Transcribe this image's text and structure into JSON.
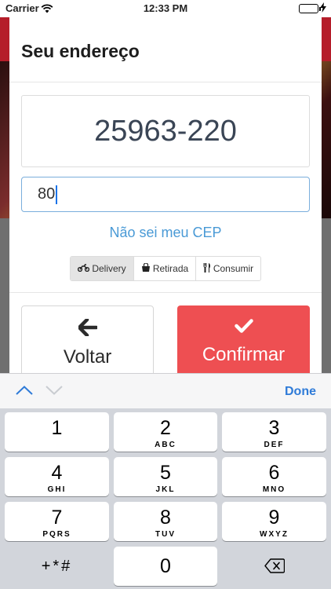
{
  "status_bar": {
    "carrier": "Carrier",
    "time": "12:33 PM"
  },
  "modal": {
    "title": "Seu endereço",
    "cep_value": "25963-220",
    "number_value": "80",
    "help_link": "Não sei meu CEP",
    "options": [
      {
        "label": "Delivery",
        "icon": "motorcycle-icon",
        "selected": true
      },
      {
        "label": "Retirada",
        "icon": "shopping-bag-icon",
        "selected": false
      },
      {
        "label": "Consumir",
        "icon": "fork-knife-icon",
        "selected": false
      }
    ],
    "back_button": {
      "label": "Voltar",
      "icon": "arrow-left-icon"
    },
    "confirm_button": {
      "label": "Confirmar",
      "icon": "check-icon"
    }
  },
  "keyboard": {
    "done_label": "Done",
    "keys": [
      {
        "digit": "1",
        "letters": ""
      },
      {
        "digit": "2",
        "letters": "ABC"
      },
      {
        "digit": "3",
        "letters": "DEF"
      },
      {
        "digit": "4",
        "letters": "GHI"
      },
      {
        "digit": "5",
        "letters": "JKL"
      },
      {
        "digit": "6",
        "letters": "MNO"
      },
      {
        "digit": "7",
        "letters": "PQRS"
      },
      {
        "digit": "8",
        "letters": "TUV"
      },
      {
        "digit": "9",
        "letters": "WXYZ"
      },
      {
        "digit": "0",
        "letters": ""
      }
    ],
    "symbols_label": "+*#"
  },
  "colors": {
    "confirm_bg": "#ee4f52",
    "link": "#4a9ad6",
    "input_border": "#7aaedc",
    "done": "#2f7bd8"
  }
}
